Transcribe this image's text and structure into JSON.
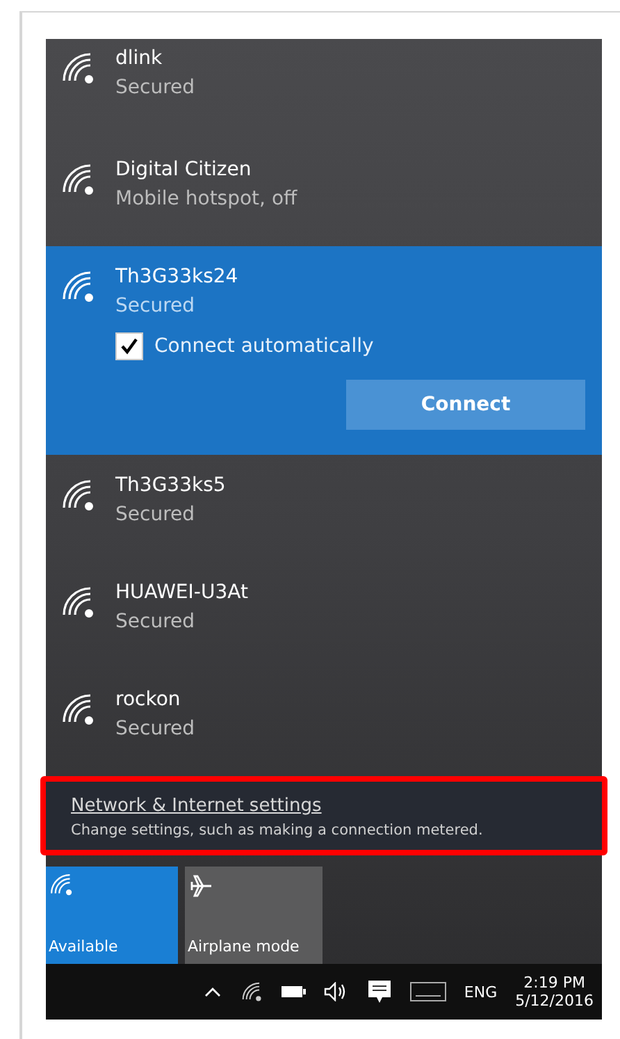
{
  "networks": [
    {
      "name": "dlink",
      "status": "Secured",
      "selected": false
    },
    {
      "name": "Digital Citizen",
      "status": "Mobile hotspot, off",
      "selected": false
    },
    {
      "name": "Th3G33ks24",
      "status": "Secured",
      "selected": true,
      "connect_automatically": {
        "label": "Connect automatically",
        "checked": true
      },
      "action": "Connect"
    },
    {
      "name": "Th3G33ks5",
      "status": "Secured",
      "selected": false
    },
    {
      "name": "HUAWEI-U3At",
      "status": "Secured",
      "selected": false
    },
    {
      "name": "rockon",
      "status": "Secured",
      "selected": false
    }
  ],
  "settings": {
    "title": "Network & Internet settings",
    "description": "Change settings, such as making a connection metered.",
    "highlighted": true
  },
  "quick_actions": [
    {
      "kind": "wifi",
      "label": "Available",
      "on": true
    },
    {
      "kind": "airplane",
      "label": "Airplane mode",
      "on": false
    }
  ],
  "taskbar": {
    "language": "ENG",
    "time": "2:19 PM",
    "date": "5/12/2016"
  }
}
